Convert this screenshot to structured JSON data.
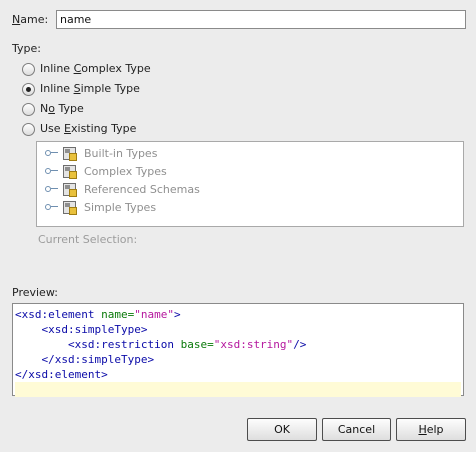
{
  "name_field": {
    "label_mnemonic": "N",
    "label_rest": "ame:",
    "value": "name"
  },
  "type_label": "Type:",
  "radios": [
    {
      "pre": "Inline ",
      "mnemonic": "C",
      "post": "omplex Type",
      "checked": false
    },
    {
      "pre": "Inline ",
      "mnemonic": "S",
      "post": "imple Type",
      "checked": true
    },
    {
      "pre": "N",
      "mnemonic": "o",
      "post": " Type",
      "checked": false
    },
    {
      "pre": "Use ",
      "mnemonic": "E",
      "post": "xisting Type",
      "checked": false
    }
  ],
  "tree": {
    "items": [
      {
        "label": "Built-in Types",
        "icon": "schema-folder-icon"
      },
      {
        "label": "Complex Types",
        "icon": "schema-folder-icon"
      },
      {
        "label": "Referenced Schemas",
        "icon": "schema-folder-icon"
      },
      {
        "label": "Simple Types",
        "icon": "schema-folder-icon"
      }
    ]
  },
  "current_selection": "Current Selection:",
  "preview_label": "Preview:",
  "preview": {
    "l1_tag_open": "<xsd:element",
    "l1_attr": "name=",
    "l1_val": "\"name\"",
    "l1_close": ">",
    "l2": "<xsd:simpleType>",
    "l3_tag_open": "<xsd:restriction",
    "l3_attr": "base=",
    "l3_val": "\"xsd:string\"",
    "l3_close": "/>",
    "l4": "</xsd:simpleType>",
    "l5": "</xsd:element>"
  },
  "buttons": {
    "ok": "OK",
    "cancel": "Cancel",
    "help_mnemonic": "H",
    "help_rest": "elp"
  }
}
